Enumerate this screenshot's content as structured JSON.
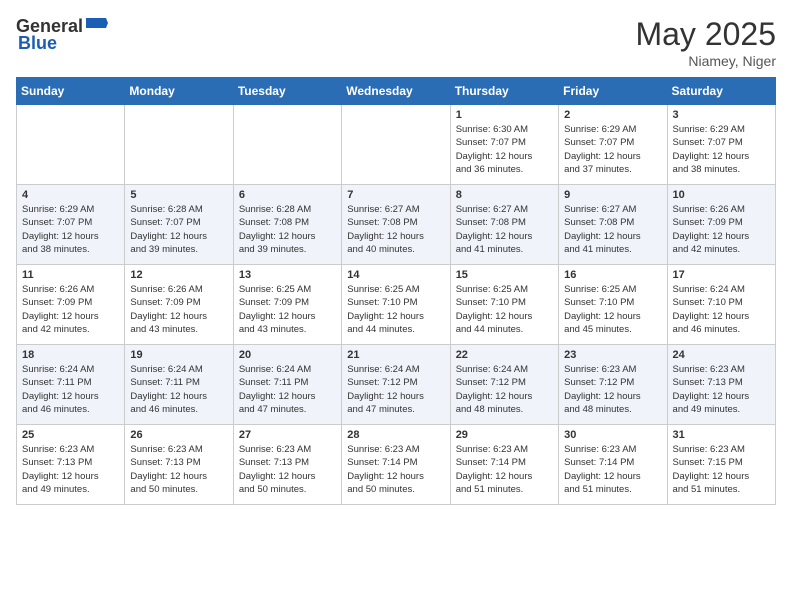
{
  "header": {
    "logo_general": "General",
    "logo_blue": "Blue",
    "month_year": "May 2025",
    "location": "Niamey, Niger"
  },
  "days_of_week": [
    "Sunday",
    "Monday",
    "Tuesday",
    "Wednesday",
    "Thursday",
    "Friday",
    "Saturday"
  ],
  "weeks": [
    [
      {
        "day": "",
        "info": ""
      },
      {
        "day": "",
        "info": ""
      },
      {
        "day": "",
        "info": ""
      },
      {
        "day": "",
        "info": ""
      },
      {
        "day": "1",
        "info": "Sunrise: 6:30 AM\nSunset: 7:07 PM\nDaylight: 12 hours\nand 36 minutes."
      },
      {
        "day": "2",
        "info": "Sunrise: 6:29 AM\nSunset: 7:07 PM\nDaylight: 12 hours\nand 37 minutes."
      },
      {
        "day": "3",
        "info": "Sunrise: 6:29 AM\nSunset: 7:07 PM\nDaylight: 12 hours\nand 38 minutes."
      }
    ],
    [
      {
        "day": "4",
        "info": "Sunrise: 6:29 AM\nSunset: 7:07 PM\nDaylight: 12 hours\nand 38 minutes."
      },
      {
        "day": "5",
        "info": "Sunrise: 6:28 AM\nSunset: 7:07 PM\nDaylight: 12 hours\nand 39 minutes."
      },
      {
        "day": "6",
        "info": "Sunrise: 6:28 AM\nSunset: 7:08 PM\nDaylight: 12 hours\nand 39 minutes."
      },
      {
        "day": "7",
        "info": "Sunrise: 6:27 AM\nSunset: 7:08 PM\nDaylight: 12 hours\nand 40 minutes."
      },
      {
        "day": "8",
        "info": "Sunrise: 6:27 AM\nSunset: 7:08 PM\nDaylight: 12 hours\nand 41 minutes."
      },
      {
        "day": "9",
        "info": "Sunrise: 6:27 AM\nSunset: 7:08 PM\nDaylight: 12 hours\nand 41 minutes."
      },
      {
        "day": "10",
        "info": "Sunrise: 6:26 AM\nSunset: 7:09 PM\nDaylight: 12 hours\nand 42 minutes."
      }
    ],
    [
      {
        "day": "11",
        "info": "Sunrise: 6:26 AM\nSunset: 7:09 PM\nDaylight: 12 hours\nand 42 minutes."
      },
      {
        "day": "12",
        "info": "Sunrise: 6:26 AM\nSunset: 7:09 PM\nDaylight: 12 hours\nand 43 minutes."
      },
      {
        "day": "13",
        "info": "Sunrise: 6:25 AM\nSunset: 7:09 PM\nDaylight: 12 hours\nand 43 minutes."
      },
      {
        "day": "14",
        "info": "Sunrise: 6:25 AM\nSunset: 7:10 PM\nDaylight: 12 hours\nand 44 minutes."
      },
      {
        "day": "15",
        "info": "Sunrise: 6:25 AM\nSunset: 7:10 PM\nDaylight: 12 hours\nand 44 minutes."
      },
      {
        "day": "16",
        "info": "Sunrise: 6:25 AM\nSunset: 7:10 PM\nDaylight: 12 hours\nand 45 minutes."
      },
      {
        "day": "17",
        "info": "Sunrise: 6:24 AM\nSunset: 7:10 PM\nDaylight: 12 hours\nand 46 minutes."
      }
    ],
    [
      {
        "day": "18",
        "info": "Sunrise: 6:24 AM\nSunset: 7:11 PM\nDaylight: 12 hours\nand 46 minutes."
      },
      {
        "day": "19",
        "info": "Sunrise: 6:24 AM\nSunset: 7:11 PM\nDaylight: 12 hours\nand 46 minutes."
      },
      {
        "day": "20",
        "info": "Sunrise: 6:24 AM\nSunset: 7:11 PM\nDaylight: 12 hours\nand 47 minutes."
      },
      {
        "day": "21",
        "info": "Sunrise: 6:24 AM\nSunset: 7:12 PM\nDaylight: 12 hours\nand 47 minutes."
      },
      {
        "day": "22",
        "info": "Sunrise: 6:24 AM\nSunset: 7:12 PM\nDaylight: 12 hours\nand 48 minutes."
      },
      {
        "day": "23",
        "info": "Sunrise: 6:23 AM\nSunset: 7:12 PM\nDaylight: 12 hours\nand 48 minutes."
      },
      {
        "day": "24",
        "info": "Sunrise: 6:23 AM\nSunset: 7:13 PM\nDaylight: 12 hours\nand 49 minutes."
      }
    ],
    [
      {
        "day": "25",
        "info": "Sunrise: 6:23 AM\nSunset: 7:13 PM\nDaylight: 12 hours\nand 49 minutes."
      },
      {
        "day": "26",
        "info": "Sunrise: 6:23 AM\nSunset: 7:13 PM\nDaylight: 12 hours\nand 50 minutes."
      },
      {
        "day": "27",
        "info": "Sunrise: 6:23 AM\nSunset: 7:13 PM\nDaylight: 12 hours\nand 50 minutes."
      },
      {
        "day": "28",
        "info": "Sunrise: 6:23 AM\nSunset: 7:14 PM\nDaylight: 12 hours\nand 50 minutes."
      },
      {
        "day": "29",
        "info": "Sunrise: 6:23 AM\nSunset: 7:14 PM\nDaylight: 12 hours\nand 51 minutes."
      },
      {
        "day": "30",
        "info": "Sunrise: 6:23 AM\nSunset: 7:14 PM\nDaylight: 12 hours\nand 51 minutes."
      },
      {
        "day": "31",
        "info": "Sunrise: 6:23 AM\nSunset: 7:15 PM\nDaylight: 12 hours\nand 51 minutes."
      }
    ]
  ]
}
